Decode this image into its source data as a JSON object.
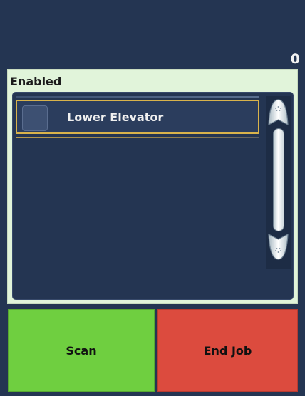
{
  "header": {
    "counter_value": "0"
  },
  "panel": {
    "title": "Enabled",
    "items": [
      {
        "label": "Lower Elevator",
        "checked": false,
        "selected": true
      }
    ]
  },
  "actions": {
    "scan_label": "Scan",
    "end_job_label": "End Job"
  },
  "colors": {
    "background": "#243552",
    "panel_background": "#e1f4da",
    "selection_border": "#d9b34b",
    "scan_button": "#6fcf40",
    "end_job_button": "#dc4b3e"
  },
  "icons": {
    "scroll_up": "chevron-up-icon",
    "scroll_down": "chevron-down-icon"
  }
}
